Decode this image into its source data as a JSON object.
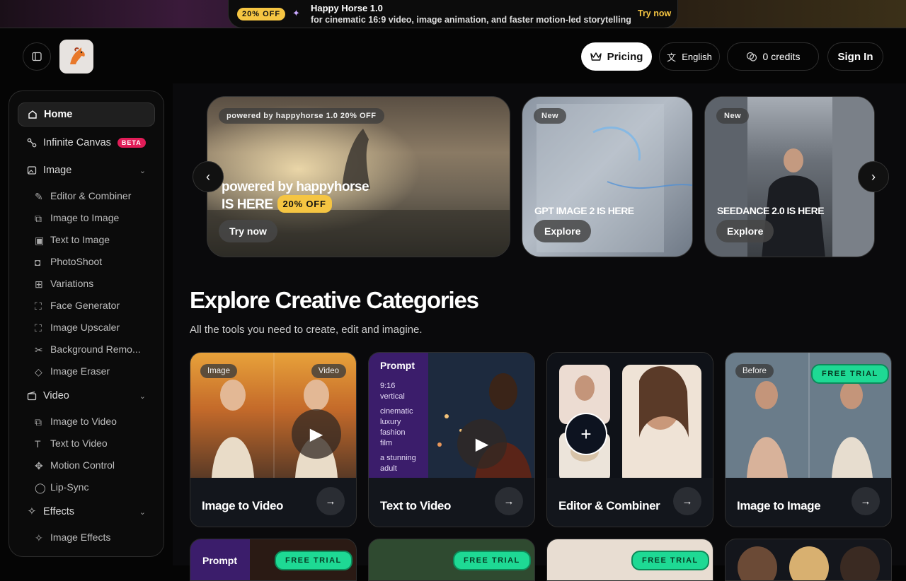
{
  "banner": {
    "discount": "20% OFF",
    "title": "Happy Horse 1.0",
    "subtitle": "for cinematic 16:9 video, image animation, and faster motion-led storytelling",
    "cta": "Try now"
  },
  "header": {
    "pricing": "Pricing",
    "language": "English",
    "credits": "0 credits",
    "sign_in": "Sign In"
  },
  "sidebar": {
    "home": "Home",
    "infinite_canvas": "Infinite Canvas",
    "beta": "BETA",
    "image": "Image",
    "image_items": [
      "Editor & Combiner",
      "Image to Image",
      "Text to Image",
      "PhotoShoot",
      "Variations",
      "Face Generator",
      "Image Upscaler",
      "Background Remo...",
      "Image Eraser"
    ],
    "video": "Video",
    "video_items": [
      "Image to Video",
      "Text to Video",
      "Motion Control",
      "Lip-Sync"
    ],
    "effects": "Effects",
    "effects_items": [
      "Image Effects"
    ]
  },
  "hero": {
    "card1": {
      "tag": "powered by happyhorse 1.0 20% OFF",
      "line1": "powered by happyhorse",
      "line2": "IS HERE",
      "badge": "20% OFF",
      "button": "Try now"
    },
    "card2": {
      "tag": "New",
      "title": "GPT IMAGE 2 IS HERE",
      "button": "Explore"
    },
    "card3": {
      "tag": "New",
      "title": "SEEDANCE 2.0 IS HERE",
      "button": "Explore"
    }
  },
  "categories_section": {
    "title": "Explore Creative Categories",
    "subtitle": "All the tools you need to create, edit and imagine."
  },
  "categories": [
    {
      "label": "Image to Video",
      "chip_left": "Image",
      "chip_right": "Video"
    },
    {
      "label": "Text to Video",
      "prompt_head": "Prompt",
      "prompt_lines": [
        "9:16 vertical",
        "cinematic luxury fashion film",
        "a stunning adult"
      ]
    },
    {
      "label": "Editor & Combiner"
    },
    {
      "label": "Image to Image",
      "chip_left": "Before",
      "free": "FREE TRIAL"
    }
  ],
  "categories_row2": [
    {
      "prompt_head": "Prompt",
      "free": "FREE TRIAL"
    },
    {
      "free": "FREE TRIAL"
    },
    {
      "free": "FREE TRIAL"
    },
    {}
  ],
  "colors": {
    "accent_yellow": "#f5c542",
    "beta_pink": "#e11d58",
    "free_green": "#1ed994",
    "prompt_purple": "#3b1d6b"
  }
}
